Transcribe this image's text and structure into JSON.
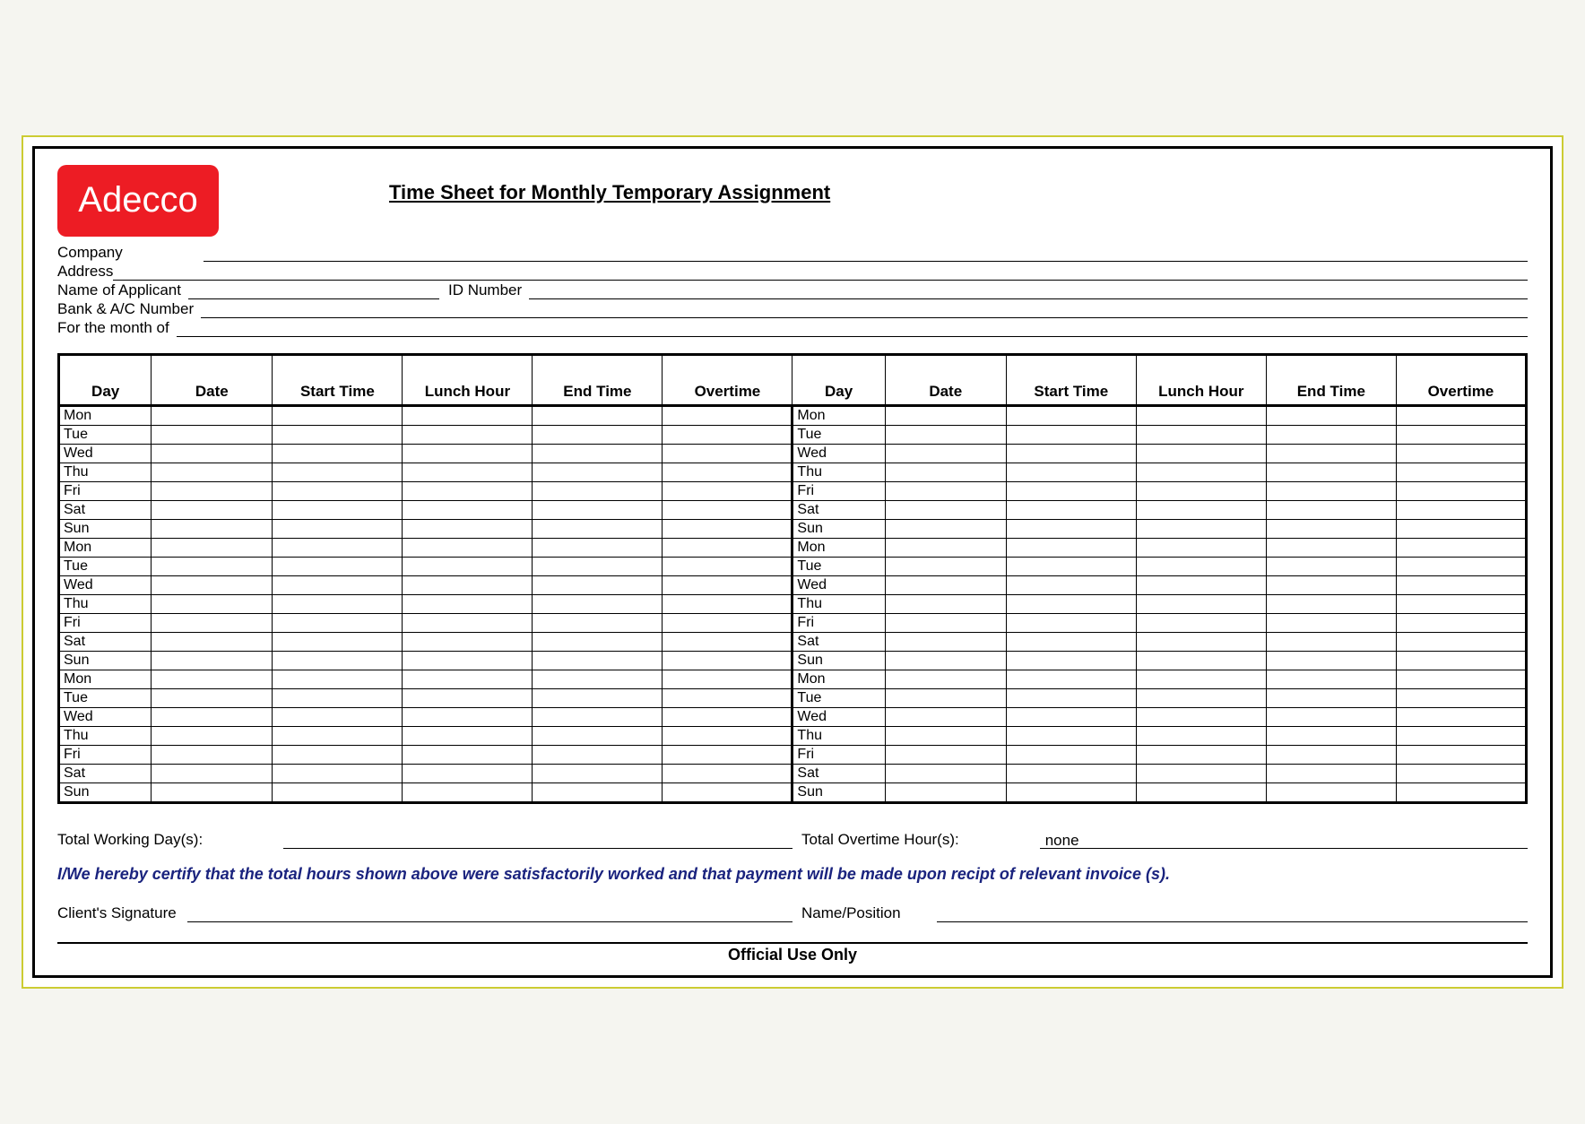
{
  "logo_text": "Adecco",
  "title": "Time Sheet for Monthly Temporary Assignment",
  "info": {
    "company": "Company",
    "address": "Address",
    "applicant": "Name of Applicant",
    "id_number": "ID Number",
    "bank": "Bank & A/C Number",
    "month": "For the month of"
  },
  "headers": {
    "day": "Day",
    "date": "Date",
    "start": "Start Time",
    "lunch": "Lunch Hour",
    "end": "End Time",
    "overtime": "Overtime"
  },
  "days": [
    "Mon",
    "Tue",
    "Wed",
    "Thu",
    "Fri",
    "Sat",
    "Sun",
    "Mon",
    "Tue",
    "Wed",
    "Thu",
    "Fri",
    "Sat",
    "Sun",
    "Mon",
    "Tue",
    "Wed",
    "Thu",
    "Fri",
    "Sat",
    "Sun"
  ],
  "totals": {
    "working_days_label": "Total Working Day(s):",
    "working_days_value": "",
    "overtime_label": "Total Overtime Hour(s):",
    "overtime_value": "none"
  },
  "certification": "I/We hereby certify that the total hours shown above were satisfactorily worked and that payment will be made upon recipt of relevant invoice (s).",
  "signature": {
    "client_label": "Client's Signature",
    "name_label": "Name/Position"
  },
  "official": "Official Use Only"
}
